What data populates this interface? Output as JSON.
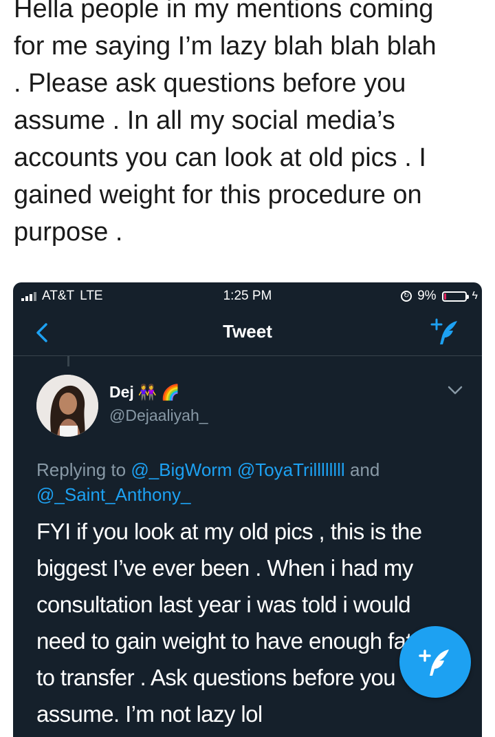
{
  "caption": {
    "text": "Hella people in my mentions coming\nfor me saying I’m lazy blah blah blah\n. Please ask questions before you\nassume . In all my social media’s\naccounts you can look at old pics . I\ngained weight for this procedure on\npurpose ."
  },
  "statusbar": {
    "carrier": "AT&T",
    "network": "LTE",
    "time": "1:25 PM",
    "battery": "9%",
    "battery_level": 0.09
  },
  "navbar": {
    "title": "Tweet",
    "back_icon": "chevron-left-icon",
    "compose_icon": "compose-tweet-icon"
  },
  "tweet": {
    "author_name": "Dej",
    "emoji_1": "👭",
    "emoji_2": "🌈",
    "handle": "@Dejaaliyah_",
    "reply_prefix": "Replying to",
    "mention_1": "@_BigWorm",
    "mention_2": "@ToyaTrillllllll",
    "reply_and": "and",
    "mention_3": "@_Saint_Anthony_",
    "body": "FYI if you look at my old pics , this is the\nbiggest I’ve ever been . When i had my\nconsultation last year i was told i would\nneed to gain weight to have enough fat\nto transfer . Ask questions before you\nassume. I’m not lazy lol"
  },
  "colors": {
    "background": "#15202b",
    "accent": "#1da1f2",
    "secondary_text": "#8899a6",
    "divider": "#38444d"
  }
}
